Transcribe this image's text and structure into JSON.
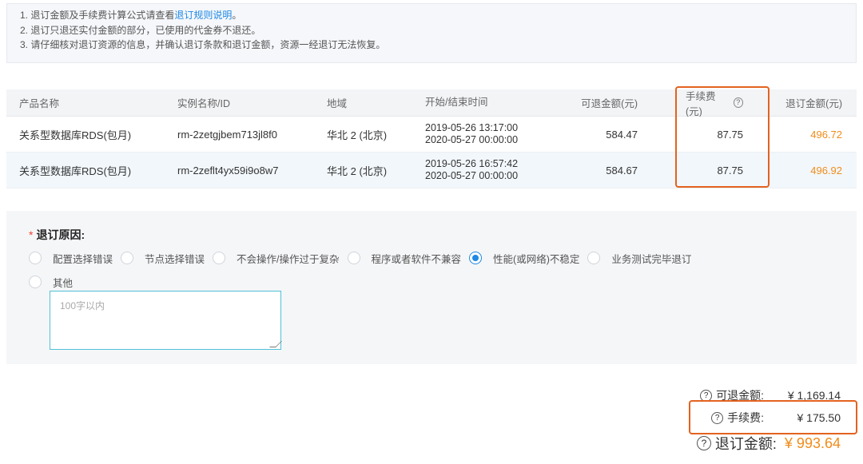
{
  "notice": {
    "line1_prefix": "1. 退订金额及手续费计算公式请查看",
    "line1_link": "退订规则说明",
    "line1_suffix": "。",
    "line2": "2. 退订只退还实付金额的部分，已使用的代金券不退还。",
    "line3": "3. 请仔细核对退订资源的信息，并确认退订条款和退订金额，资源一经退订无法恢复。"
  },
  "table": {
    "headers": {
      "product": "产品名称",
      "instance": "实例名称/ID",
      "region": "地域",
      "time": "开始/结束时间",
      "refundable": "可退金额(元)",
      "fee": "手续费(元)",
      "refund": "退订金额(元)"
    },
    "rows": [
      {
        "product": "关系型数据库RDS(包月)",
        "instance": "rm-2zetgjbem713jl8f0",
        "region": "华北 2 (北京)",
        "start": "2019-05-26 13:17:00",
        "end": "2020-05-27 00:00:00",
        "refundable": "584.47",
        "fee": "87.75",
        "refund": "496.72"
      },
      {
        "product": "关系型数据库RDS(包月)",
        "instance": "rm-2zeflt4yx59i9o8w7",
        "region": "华北 2 (北京)",
        "start": "2019-05-26 16:57:42",
        "end": "2020-05-27 00:00:00",
        "refundable": "584.67",
        "fee": "87.75",
        "refund": "496.92"
      }
    ]
  },
  "reason": {
    "title": "退订原因:",
    "options": [
      "配置选择错误",
      "节点选择错误",
      "不会操作/操作过于复杂",
      "程序或者软件不兼容",
      "性能(或网络)不稳定",
      "业务测试完毕退订",
      "其他"
    ],
    "selected": "性能(或网络)不稳定",
    "placeholder": "100字以内"
  },
  "summary": {
    "refundable_label": "可退金额:",
    "refundable_value": "¥ 1,169.14",
    "fee_label": "手续费:",
    "fee_value": "¥ 175.50",
    "total_label": "退订金额:",
    "total_value": "¥ 993.64"
  },
  "colors": {
    "accent": "#f08c1a",
    "link": "#1e88e5",
    "highlight": "#e3621f"
  }
}
